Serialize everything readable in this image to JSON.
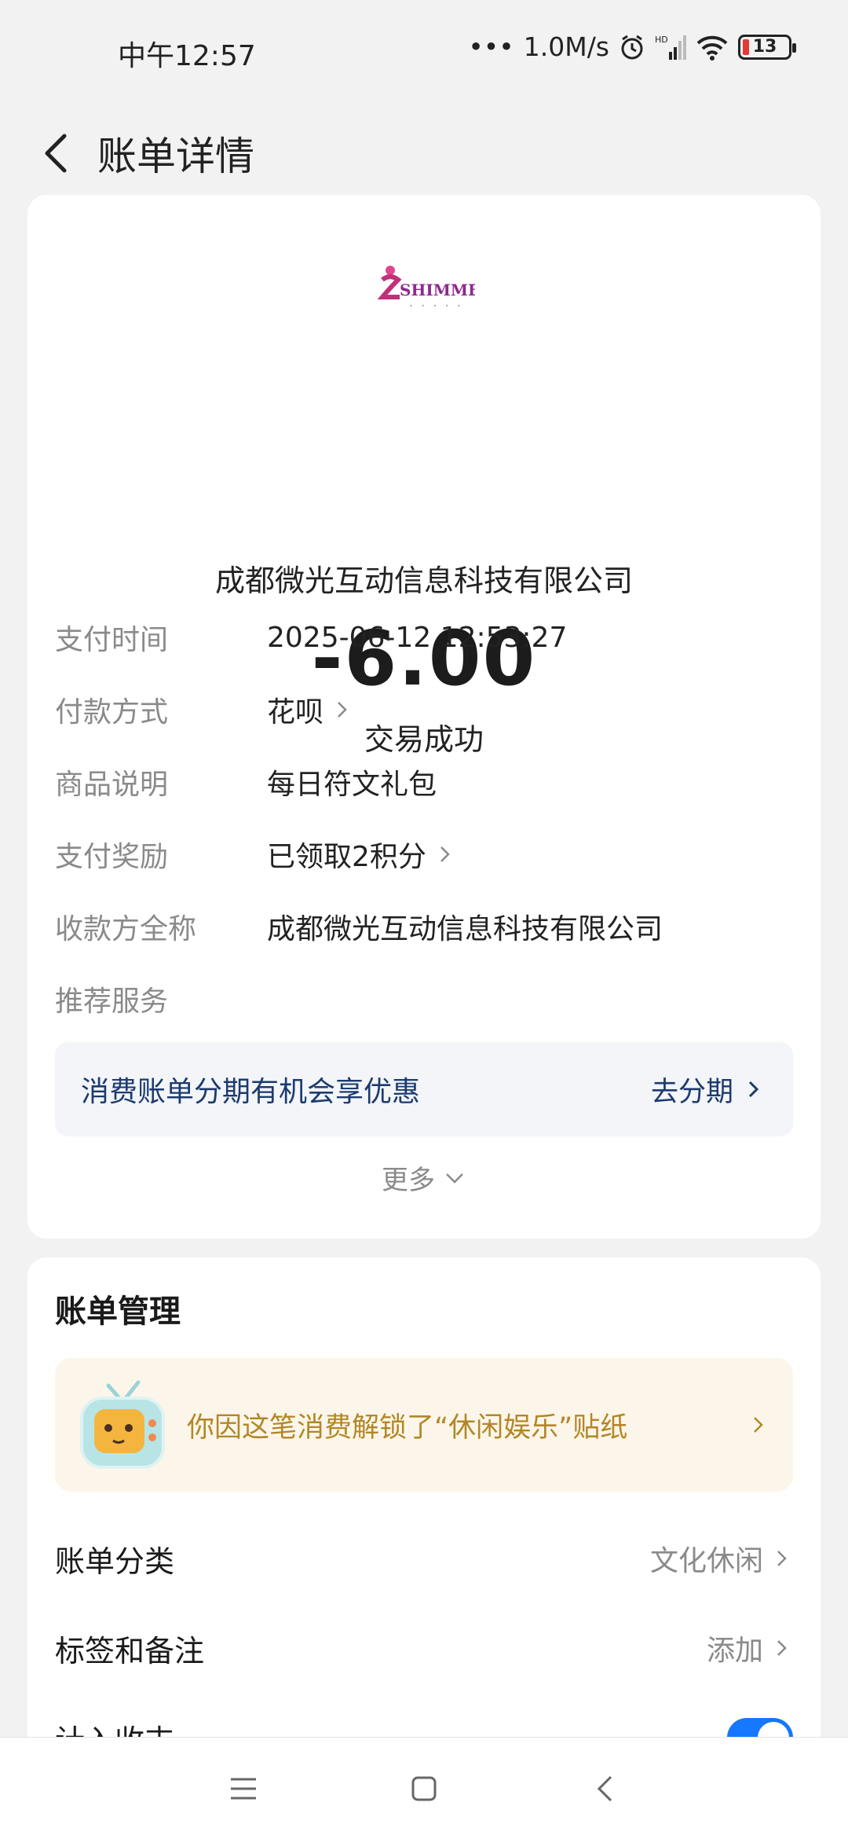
{
  "status_bar": {
    "time": "中午12:57",
    "network_speed": "1.0M/s",
    "battery": "13"
  },
  "header": {
    "title": "账单详情"
  },
  "summary": {
    "merchant": "成都微光互动信息科技有限公司",
    "amount": "-6.00",
    "status": "交易成功",
    "logo_text": "SHIMMER"
  },
  "details": [
    {
      "label": "支付时间",
      "value": "2025-06-12 12:53:27"
    },
    {
      "label": "付款方式",
      "value": "花呗"
    },
    {
      "label": "商品说明",
      "value": "每日符文礼包"
    },
    {
      "label": "支付奖励",
      "value": "已领取2积分"
    },
    {
      "label": "收款方全称",
      "value": "成都微光互动信息科技有限公司"
    },
    {
      "label": "推荐服务",
      "value": ""
    }
  ],
  "promo": {
    "text": "消费账单分期有机会享优惠",
    "action": "去分期"
  },
  "more_label": "更多",
  "management": {
    "title": "账单管理",
    "sticker_text": "你因这笔消费解锁了“休闲娱乐”贴纸",
    "rows": [
      {
        "label": "账单分类",
        "value": "文化休闲"
      },
      {
        "label": "标签和备注",
        "value": "添加"
      },
      {
        "label": "计入收支",
        "value": ""
      }
    ]
  },
  "colors": {
    "accent_blue": "#1677ff",
    "promo_text": "#1c3b6e",
    "sticker_text": "#b38726"
  }
}
